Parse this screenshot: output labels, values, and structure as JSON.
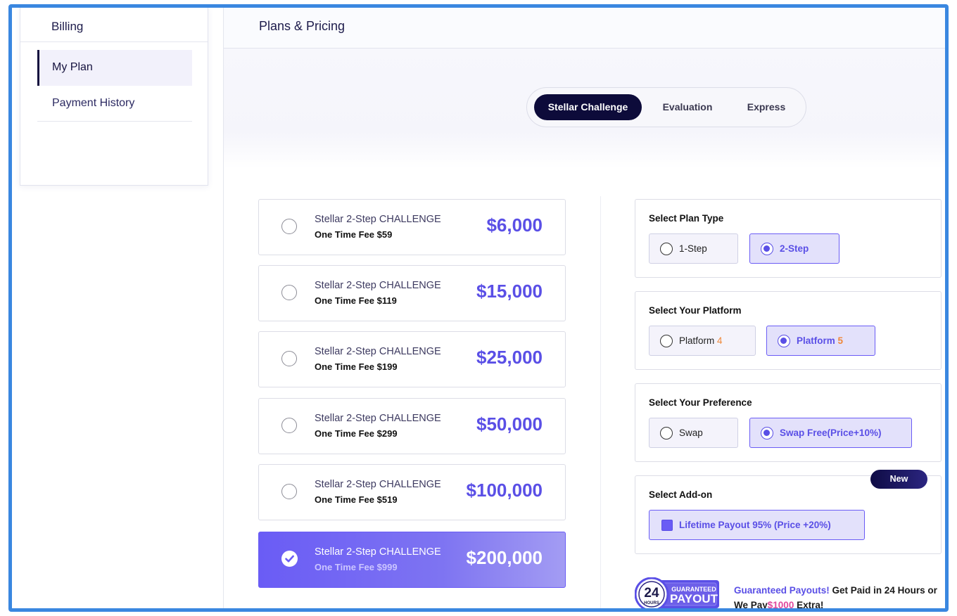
{
  "sidebar": {
    "title": "Billing",
    "items": [
      {
        "label": "My Plan"
      },
      {
        "label": "Payment History"
      }
    ]
  },
  "header": {
    "title": "Plans & Pricing"
  },
  "tabs": [
    {
      "label": "Stellar Challenge"
    },
    {
      "label": "Evaluation"
    },
    {
      "label": "Express"
    }
  ],
  "plans": [
    {
      "title": "Stellar 2-Step CHALLENGE",
      "fee": "One Time Fee $59",
      "amount": "$6,000"
    },
    {
      "title": "Stellar 2-Step CHALLENGE",
      "fee": "One Time Fee $119",
      "amount": "$15,000"
    },
    {
      "title": "Stellar 2-Step CHALLENGE",
      "fee": "One Time Fee $199",
      "amount": "$25,000"
    },
    {
      "title": "Stellar 2-Step CHALLENGE",
      "fee": "One Time Fee $299",
      "amount": "$50,000"
    },
    {
      "title": "Stellar 2-Step CHALLENGE",
      "fee": "One Time Fee $519",
      "amount": "$100,000"
    },
    {
      "title": "Stellar 2-Step CHALLENGE",
      "fee": "One Time Fee $999",
      "amount": "$200,000"
    }
  ],
  "plan_type": {
    "title": "Select Plan Type",
    "options": [
      "1-Step",
      "2-Step"
    ]
  },
  "platform": {
    "title": "Select Your Platform",
    "prefix": "Platform",
    "options": [
      "4",
      "5"
    ]
  },
  "preference": {
    "title": "Select Your Preference",
    "options": [
      "Swap",
      "Swap Free(Price+10%)"
    ]
  },
  "addon": {
    "title": "Select Add-on",
    "badge": "New",
    "option": "Lifetime Payout 95% (Price +20%)"
  },
  "payout": {
    "logo_number": "24",
    "logo_unit": "HOURS",
    "logo_line1": "GUARANTEED",
    "logo_line2": "PAYOUT",
    "highlight": "Guaranteed Payouts!",
    "text1": " Get Paid in 24 Hours or",
    "text2": "We Pay",
    "amount": "$1000",
    "text3": " Extra!"
  },
  "colors": {
    "accent": "#5a4fe6",
    "dark": "#0d0b3a",
    "frame": "#3a87e0",
    "platform_number": "#f0883a",
    "pink": "#e0489c"
  }
}
